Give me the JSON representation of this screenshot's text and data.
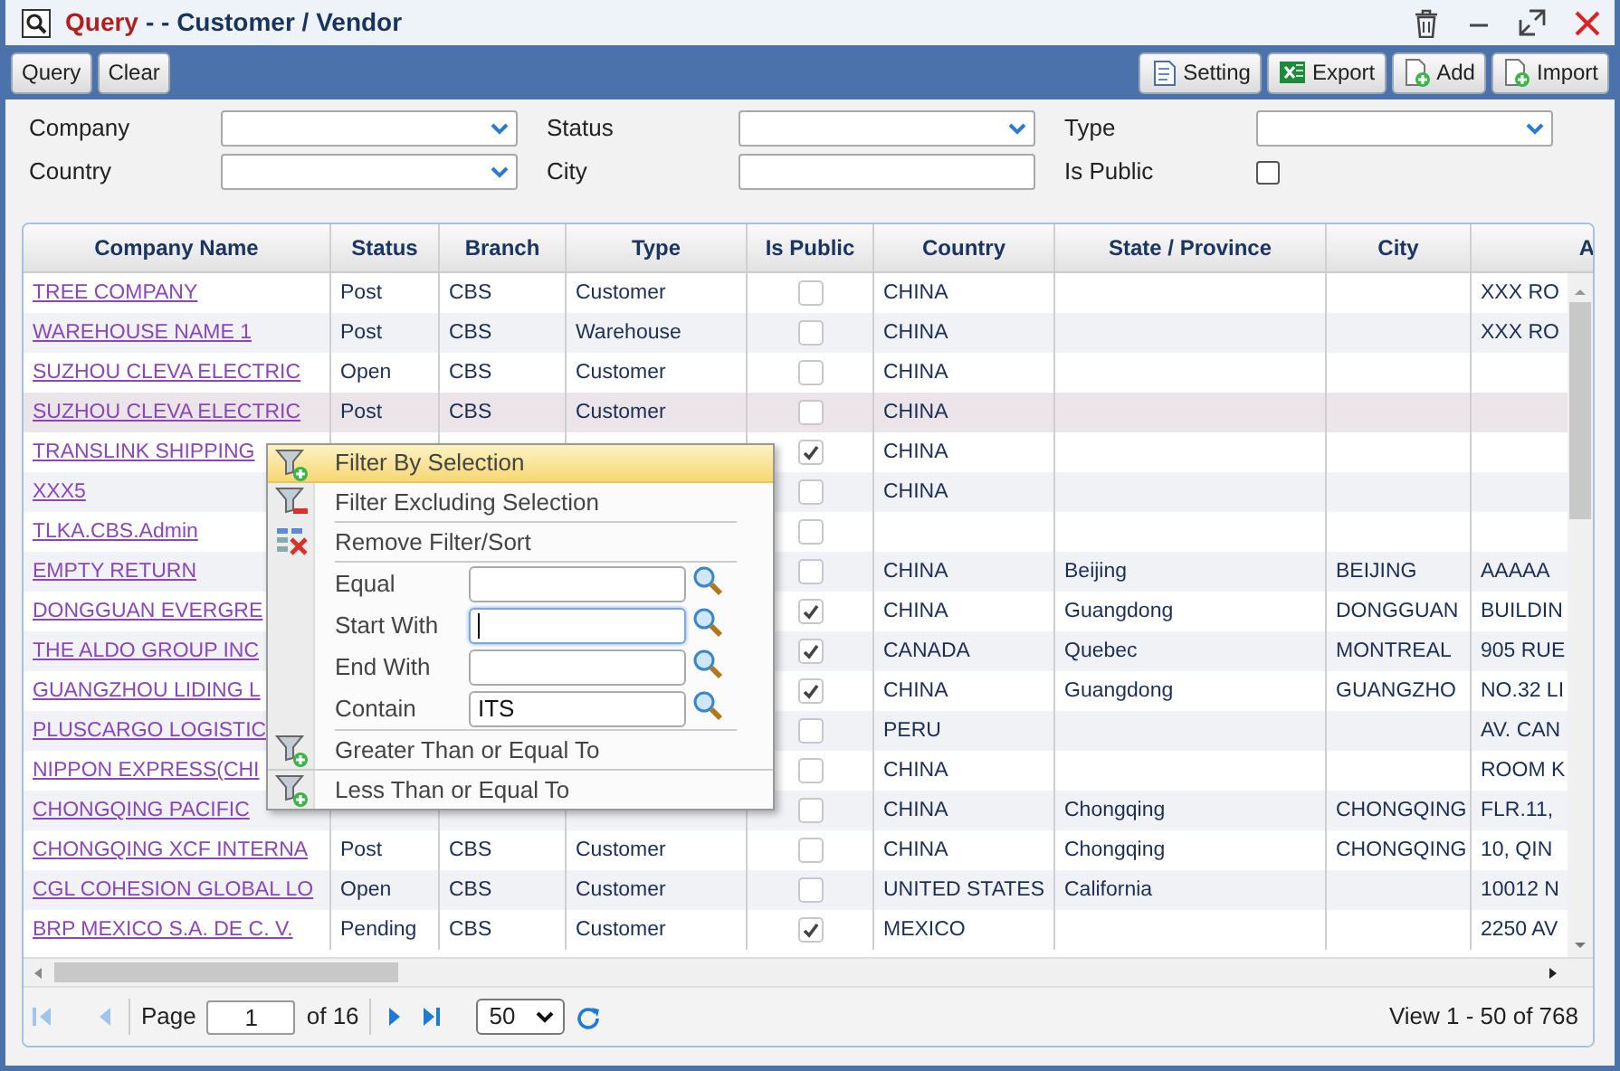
{
  "window": {
    "app": "Query",
    "title": "- - Customer / Vendor"
  },
  "toolbar": {
    "left": [
      {
        "label": "Query"
      },
      {
        "label": "Clear"
      }
    ],
    "right": [
      {
        "label": "Setting"
      },
      {
        "label": "Export"
      },
      {
        "label": "Add"
      },
      {
        "label": "Import"
      }
    ]
  },
  "filters": [
    {
      "label": "Company",
      "kind": "select"
    },
    {
      "label": "Status",
      "kind": "select"
    },
    {
      "label": "Type",
      "kind": "select"
    },
    {
      "label": "Country",
      "kind": "select"
    },
    {
      "label": "City",
      "kind": "text"
    },
    {
      "label": "Is Public",
      "kind": "checkbox",
      "checked": false
    }
  ],
  "table": {
    "columns": [
      "Company Name",
      "Status",
      "Branch",
      "Type",
      "Is Public",
      "Country",
      "State / Province",
      "City",
      "A"
    ],
    "rows": [
      {
        "company_name": "TREE COMPANY",
        "status": "Post",
        "branch": "CBS",
        "type": "Customer",
        "is_public": false,
        "country": "CHINA",
        "column_9": "XXX RO",
        "selected": false
      },
      {
        "company_name": "WAREHOUSE NAME 1",
        "status": "Post",
        "branch": "CBS",
        "type": "Warehouse",
        "is_public": false,
        "country": "CHINA",
        "column_9": "XXX RO",
        "selected": false
      },
      {
        "company_name": "SUZHOU CLEVA ELECTRIC",
        "status": "Open",
        "branch": "CBS",
        "type": "Customer",
        "is_public": false,
        "country": "CHINA",
        "selected": false
      },
      {
        "company_name": "SUZHOU CLEVA ELECTRIC",
        "status": "Post",
        "branch": "CBS",
        "type": "Customer",
        "is_public": false,
        "country": "CHINA",
        "selected": true
      },
      {
        "company_name": "TRANSLINK SHIPPING",
        "is_public": true,
        "country": "CHINA",
        "selected": false
      },
      {
        "company_name": "XXX5",
        "is_public": false,
        "country": "CHINA",
        "selected": false
      },
      {
        "company_name": "TLKA.CBS.Admin",
        "is_public": false,
        "selected": false
      },
      {
        "company_name": "EMPTY RETURN",
        "is_public": false,
        "country": "CHINA",
        "state_province": "Beijing",
        "city": "BEIJING",
        "column_9": "AAAAA",
        "selected": false
      },
      {
        "company_name": "DONGGUAN EVERGRE",
        "is_public": true,
        "country": "CHINA",
        "state_province": "Guangdong",
        "city": "DONGGUAN",
        "column_9": "BUILDIN",
        "selected": false
      },
      {
        "company_name": "THE ALDO GROUP INC",
        "is_public": true,
        "country": "CANADA",
        "state_province": "Quebec",
        "city": "MONTREAL",
        "column_9": "905 RUE",
        "selected": false
      },
      {
        "company_name": "GUANGZHOU LIDING L",
        "is_public": true,
        "country": "CHINA",
        "state_province": "Guangdong",
        "city": "GUANGZHO",
        "column_9": "NO.32 LI",
        "selected": false
      },
      {
        "company_name": "PLUSCARGO LOGISTIC",
        "is_public": false,
        "country": "PERU",
        "column_9": "AV. CAN",
        "selected": false
      },
      {
        "company_name": "NIPPON EXPRESS(CHI",
        "is_public": false,
        "country": "CHINA",
        "column_9": "ROOM K",
        "selected": false
      },
      {
        "company_name": "CHONGQING PACIFIC",
        "is_public": false,
        "country": "CHINA",
        "state_province": "Chongqing",
        "city": "CHONGQING",
        "column_9": "FLR.11,",
        "selected": false
      },
      {
        "company_name": "CHONGQING XCF INTERNA",
        "status": "Post",
        "branch": "CBS",
        "type": "Customer",
        "is_public": false,
        "country": "CHINA",
        "state_province": "Chongqing",
        "city": "CHONGQING",
        "column_9": "10, QIN",
        "selected": false
      },
      {
        "company_name": "CGL COHESION GLOBAL LO",
        "status": "Open",
        "branch": "CBS",
        "type": "Customer",
        "is_public": false,
        "country": "UNITED STATES",
        "state_province": "California",
        "column_9": "10012 N",
        "selected": false
      },
      {
        "company_name": "BRP MEXICO S.A. DE C. V.",
        "status": "Pending",
        "branch": "CBS",
        "type": "Customer",
        "is_public": true,
        "country": "MEXICO",
        "column_9": "2250 AV",
        "selected": false
      }
    ]
  },
  "context_menu": [
    {
      "kind": "action",
      "label": "Filter By Selection",
      "selected": true
    },
    {
      "kind": "action",
      "label": "Filter Excluding Selection",
      "selected": false
    },
    {
      "kind": "action",
      "label": "Remove Filter/Sort",
      "selected": false
    },
    {
      "kind": "field",
      "label": "Equal",
      "focused": false
    },
    {
      "kind": "field",
      "label": "Start With",
      "focused": true
    },
    {
      "kind": "field",
      "label": "End With",
      "focused": false
    },
    {
      "kind": "field",
      "label": "Contain",
      "value": "ITS",
      "focused": false
    },
    {
      "kind": "action",
      "label": "Greater Than or Equal To",
      "selected": false
    },
    {
      "kind": "action",
      "label": "Less Than or Equal To",
      "selected": false
    }
  ],
  "pager": {
    "page_label": "Page",
    "page": "1",
    "of": "of 16",
    "page_size": "50",
    "summary": "View 1 - 50 of 768"
  }
}
